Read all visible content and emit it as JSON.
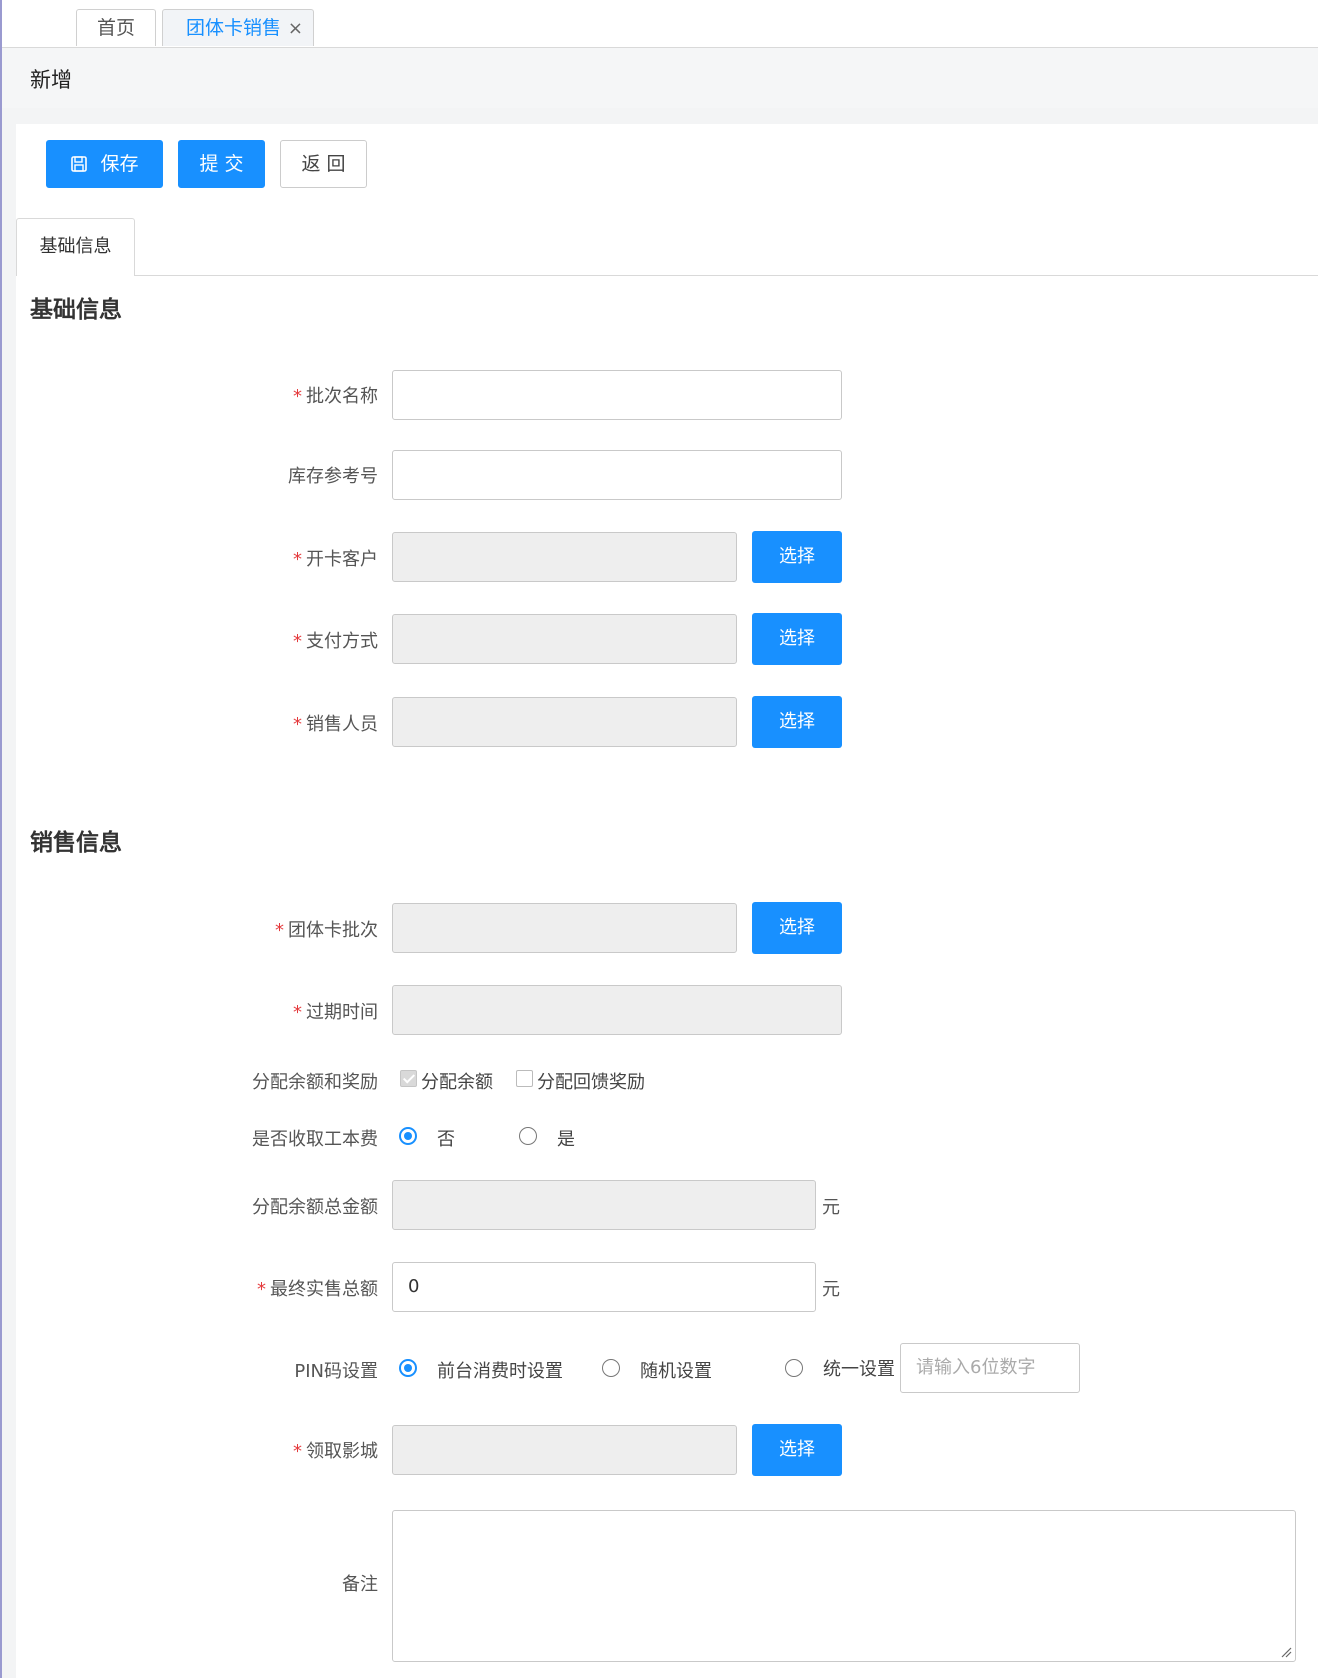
{
  "tabs": {
    "home": "首页",
    "active": "团体卡销售",
    "close": "×"
  },
  "page": {
    "title": "新增"
  },
  "toolbar": {
    "save": "保存",
    "submit": "提 交",
    "back": "返 回"
  },
  "section_tab": "基础信息",
  "basic": {
    "heading": "基础信息",
    "batch_name": "批次名称",
    "stock_ref": "库存参考号",
    "customer": "开卡客户",
    "payment": "支付方式",
    "sales_person": "销售人员",
    "select": "选择"
  },
  "sales": {
    "heading": "销售信息",
    "card_batch": "团体卡批次",
    "expire": "过期时间",
    "allocate_label": "分配余额和奖励",
    "allocate_balance": "分配余额",
    "allocate_reward": "分配回馈奖励",
    "fee_label": "是否收取工本费",
    "fee_no": "否",
    "fee_yes": "是",
    "total_balance_label": "分配余额总金额",
    "unit": "元",
    "final_total_label": "最终实售总额",
    "final_total_value": "0",
    "pin_label": "PIN码设置",
    "pin_opt1": "前台消费时设置",
    "pin_opt2": "随机设置",
    "pin_opt3": "统一设置",
    "pin_placeholder": "请输入6位数字",
    "cinema_label": "领取影城",
    "remark_label": "备注",
    "select": "选择"
  },
  "colors": {
    "primary": "#1890ff",
    "required": "#e4393c",
    "disabled_bg": "#eeeeee"
  }
}
